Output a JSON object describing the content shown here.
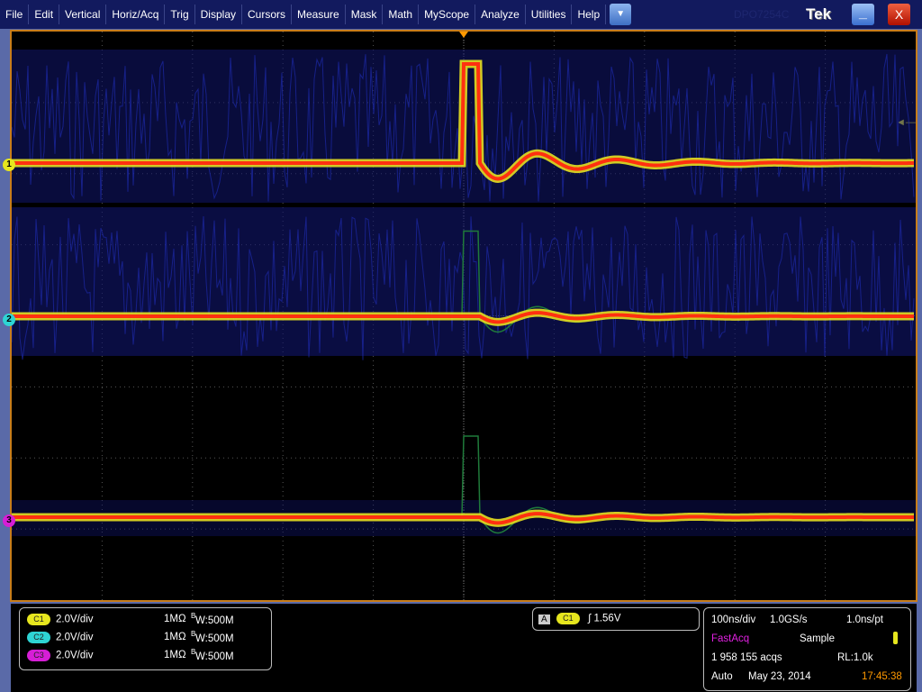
{
  "menu": [
    "File",
    "Edit",
    "Vertical",
    "Horiz/Acq",
    "Trig",
    "Display",
    "Cursors",
    "Measure",
    "Mask",
    "Math",
    "MyScope",
    "Analyze",
    "Utilities",
    "Help"
  ],
  "menu_dropdown_icon": "triangle-down-icon",
  "model": "DPO7254C",
  "brand": "Tek",
  "minimize_label": "_",
  "close_label": "X",
  "channels": [
    {
      "id": "C1",
      "marker": "1",
      "scale": "2.0V/div",
      "impedance": "1MΩ",
      "bw": "W:500M",
      "bw_sup": "B",
      "color": "#e6e61e"
    },
    {
      "id": "C2",
      "marker": "2",
      "scale": "2.0V/div",
      "impedance": "1MΩ",
      "bw": "W:500M",
      "bw_sup": "B",
      "color": "#2ed4d4"
    },
    {
      "id": "C3",
      "marker": "3",
      "scale": "2.0V/div",
      "impedance": "1MΩ",
      "bw": "W:500M",
      "bw_sup": "B",
      "color": "#d61ed6"
    }
  ],
  "trigger": {
    "mode": "A",
    "source": "C1",
    "slope": "rising",
    "slope_glyph": "∫",
    "level": "1.56V"
  },
  "acq": {
    "timebase": "100ns/div",
    "sample_rate": "1.0GS/s",
    "resolution": "1.0ns/pt",
    "mode": "FastAcq",
    "sampling": "Sample",
    "acqs": "1 958 155 acqs",
    "record_length": "RL:1.0k",
    "trigger_mode": "Auto",
    "date": "May 23, 2014",
    "time": "17:45:38"
  },
  "colors": {
    "graticule_border": "#c87d1a",
    "fastacq": "#e020e0",
    "time": "#ff9900",
    "persistence_blue": "#1a1f8a"
  }
}
